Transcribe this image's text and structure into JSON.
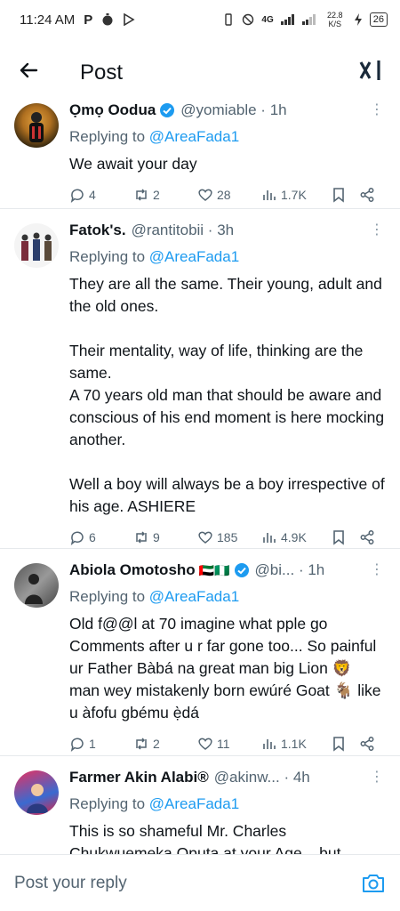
{
  "status_bar": {
    "time": "11:24 AM",
    "left_icons": [
      "P",
      "timer-icon",
      "play-store-icon"
    ],
    "network": "4G",
    "speed": "22.8 K/S",
    "battery": "26"
  },
  "header": {
    "title": "Post",
    "logo": "x-ai-logo"
  },
  "tweets": [
    {
      "name": "Ọmọ Oodua",
      "handle": "@yomiable",
      "time": "1h",
      "verified": true,
      "replying_prefix": "Replying to",
      "replying_to": "@AreaFada1",
      "body": [
        "We await your day"
      ],
      "replies": "4",
      "reposts": "2",
      "likes": "28",
      "views": "1.7K"
    },
    {
      "name": "Fatok's.",
      "handle": "@rantitobii",
      "time": "3h",
      "verified": false,
      "replying_prefix": "Replying to",
      "replying_to": "@AreaFada1",
      "body": [
        "They are all the same. Their young, adult and the old ones.",
        "",
        "Their mentality, way of life, thinking are the same.",
        "A 70 years old man that should be aware and conscious of his end moment is here mocking another.",
        "",
        "Well a boy will always be a boy irrespective of his age. ASHIERE"
      ],
      "replies": "6",
      "reposts": "9",
      "likes": "185",
      "views": "4.9K"
    },
    {
      "name": "Abiola Omotosho",
      "flags": "🇦🇪🇳🇬",
      "handle": "@bi...",
      "time": "1h",
      "verified": true,
      "replying_prefix": "Replying to",
      "replying_to": "@AreaFada1",
      "body": [
        "Old f@@l at 70 imagine what pple go Comments after u r far gone too... So painful ur Father Bàbá na great man big Lion 🦁 man wey mistakenly born ewúré Goat 🐐 like u àfofu gbému ẹ̀dá"
      ],
      "replies": "1",
      "reposts": "2",
      "likes": "11",
      "views": "1.1K"
    },
    {
      "name": "Farmer Akin Alabi®",
      "handle": "@akinw...",
      "time": "4h",
      "verified": false,
      "replying_prefix": "Replying to",
      "replying_to": "@AreaFada1",
      "body": [
        "This is so shameful Mr. Charles Chukwuemeka Oputa at your Age... but"
      ]
    }
  ],
  "reply_bar": {
    "placeholder": "Post your reply",
    "icon": "camera-icon"
  },
  "colors": {
    "accent": "#1d9bf0",
    "secondary_text": "#536471",
    "divider": "#e6e9ec"
  }
}
